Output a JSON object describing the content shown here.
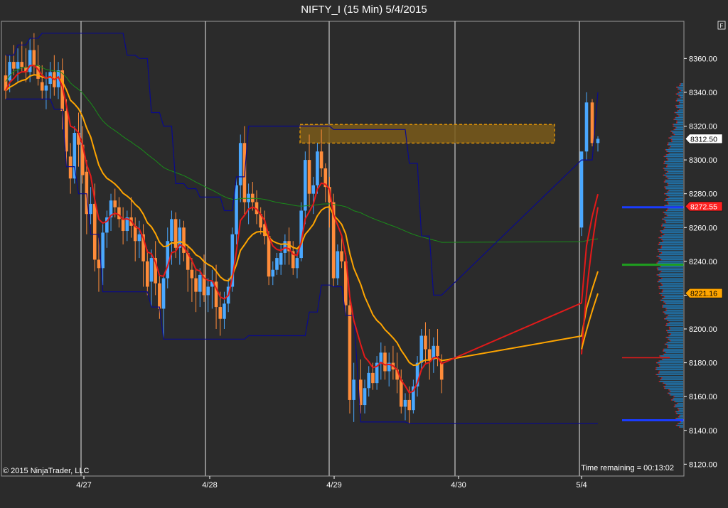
{
  "chart_data": {
    "type": "candlestick",
    "title": "NIFTY_I (15 Min)  5/4/2015",
    "x_labels": [
      "4/27",
      "4/28",
      "4/29",
      "4/30",
      "5/4"
    ],
    "y_ticks": [
      8120,
      8140,
      8160,
      8180,
      8200,
      8220,
      8240,
      8260,
      8280,
      8300,
      8320,
      8340,
      8360
    ],
    "y_tick_labels": [
      "8120.00",
      "8140.00",
      "8160.00",
      "8180.00",
      "8200.00",
      "8220.00",
      "8240.00",
      "8260.00",
      "8280.00",
      "8300.00",
      "8320.00",
      "8340.00",
      "8360.00"
    ],
    "ylim": [
      8113,
      8382
    ],
    "price_markers": [
      {
        "value": 8312.5,
        "label": "8312.50",
        "color": "#ffffff",
        "text_color": "#000000"
      },
      {
        "value": 8272.55,
        "label": "8272.55",
        "color": "#ff2020",
        "text_color": "#ffffff"
      },
      {
        "value": 8221.16,
        "label": "8221.16",
        "color": "#ffa500",
        "text_color": "#000000"
      }
    ],
    "resistance_zone": {
      "from": 8310,
      "to": 8321
    },
    "candles": [
      [
        8350,
        8362,
        8336,
        8341
      ],
      [
        8347,
        8362,
        8340,
        8358
      ],
      [
        8358,
        8368,
        8350,
        8354
      ],
      [
        8354,
        8366,
        8346,
        8358
      ],
      [
        8358,
        8370,
        8352,
        8355
      ],
      [
        8355,
        8366,
        8346,
        8352
      ],
      [
        8352,
        8372,
        8346,
        8365
      ],
      [
        8365,
        8375,
        8350,
        8356
      ],
      [
        8356,
        8368,
        8344,
        8348
      ],
      [
        8346,
        8356,
        8336,
        8341
      ],
      [
        8341,
        8352,
        8330,
        8344
      ],
      [
        8345,
        8358,
        8336,
        8352
      ],
      [
        8352,
        8362,
        8338,
        8343
      ],
      [
        8343,
        8358,
        8336,
        8353
      ],
      [
        8353,
        8360,
        8318,
        8329
      ],
      [
        8329,
        8336,
        8296,
        8305
      ],
      [
        8302,
        8310,
        8280,
        8289
      ],
      [
        8289,
        8320,
        8286,
        8316
      ],
      [
        8316,
        8328,
        8296,
        8309
      ],
      [
        8309,
        8320,
        8286,
        8291
      ],
      [
        8293,
        8300,
        8256,
        8268
      ],
      [
        8268,
        8284,
        8262,
        8274
      ],
      [
        8274,
        8286,
        8234,
        8241
      ],
      [
        8241,
        8254,
        8222,
        8236
      ],
      [
        8236,
        8262,
        8226,
        8257
      ],
      [
        8257,
        8270,
        8248,
        8266
      ],
      [
        8266,
        8280,
        8258,
        8276
      ],
      [
        8276,
        8283,
        8266,
        8272
      ],
      [
        8272,
        8278,
        8260,
        8265
      ],
      [
        8265,
        8272,
        8250,
        8258
      ],
      [
        8258,
        8270,
        8252,
        8266
      ],
      [
        8266,
        8278,
        8254,
        8261
      ],
      [
        8261,
        8266,
        8240,
        8252
      ],
      [
        8252,
        8264,
        8242,
        8256
      ],
      [
        8256,
        8262,
        8225,
        8240
      ],
      [
        8240,
        8247,
        8220,
        8225
      ],
      [
        8228,
        8247,
        8213,
        8242
      ],
      [
        8242,
        8252,
        8220,
        8227
      ],
      [
        8227,
        8232,
        8206,
        8212
      ],
      [
        8212,
        8232,
        8194,
        8230
      ],
      [
        8230,
        8260,
        8224,
        8252
      ],
      [
        8252,
        8270,
        8238,
        8265
      ],
      [
        8265,
        8269,
        8242,
        8248
      ],
      [
        8248,
        8265,
        8238,
        8260
      ],
      [
        8260,
        8264,
        8240,
        8245
      ],
      [
        8245,
        8250,
        8222,
        8235
      ],
      [
        8235,
        8242,
        8216,
        8230
      ],
      [
        8230,
        8236,
        8210,
        8222
      ],
      [
        8222,
        8236,
        8213,
        8232
      ],
      [
        8232,
        8244,
        8216,
        8220
      ],
      [
        8220,
        8230,
        8210,
        8225
      ],
      [
        8225,
        8235,
        8212,
        8228
      ],
      [
        8228,
        8238,
        8200,
        8213
      ],
      [
        8213,
        8222,
        8196,
        8206
      ],
      [
        8206,
        8222,
        8200,
        8215
      ],
      [
        8215,
        8230,
        8210,
        8225
      ],
      [
        8225,
        8260,
        8222,
        8256
      ],
      [
        8256,
        8290,
        8250,
        8285
      ],
      [
        8285,
        8315,
        8275,
        8310
      ],
      [
        8310,
        8320,
        8268,
        8275
      ],
      [
        8275,
        8286,
        8262,
        8280
      ],
      [
        8280,
        8287,
        8270,
        8275
      ],
      [
        8275,
        8282,
        8262,
        8268
      ],
      [
        8268,
        8272,
        8256,
        8260
      ],
      [
        8262,
        8270,
        8250,
        8255
      ],
      [
        8255,
        8258,
        8226,
        8231
      ],
      [
        8231,
        8240,
        8226,
        8235
      ],
      [
        8235,
        8245,
        8232,
        8242
      ],
      [
        8238,
        8250,
        8232,
        8245
      ],
      [
        8245,
        8256,
        8238,
        8252
      ],
      [
        8252,
        8260,
        8238,
        8246
      ],
      [
        8246,
        8252,
        8232,
        8236
      ],
      [
        8236,
        8248,
        8230,
        8242
      ],
      [
        8242,
        8275,
        8240,
        8270
      ],
      [
        8270,
        8305,
        8262,
        8300
      ],
      [
        8300,
        8315,
        8272,
        8280
      ],
      [
        8280,
        8290,
        8268,
        8285
      ],
      [
        8285,
        8310,
        8280,
        8305
      ],
      [
        8305,
        8318,
        8290,
        8295
      ],
      [
        8295,
        8298,
        8275,
        8284
      ],
      [
        8284,
        8290,
        8260,
        8275
      ],
      [
        8275,
        8280,
        8225,
        8230
      ],
      [
        8230,
        8250,
        8226,
        8246
      ],
      [
        8246,
        8255,
        8236,
        8240
      ],
      [
        8240,
        8245,
        8208,
        8214
      ],
      [
        8214,
        8220,
        8150,
        8158
      ],
      [
        8158,
        8180,
        8145,
        8170
      ],
      [
        8170,
        8182,
        8150,
        8155
      ],
      [
        8155,
        8170,
        8150,
        8165
      ],
      [
        8165,
        8178,
        8160,
        8174
      ],
      [
        8174,
        8180,
        8164,
        8168
      ],
      [
        8168,
        8184,
        8164,
        8180
      ],
      [
        8180,
        8192,
        8170,
        8186
      ],
      [
        8186,
        8190,
        8170,
        8175
      ],
      [
        8175,
        8186,
        8166,
        8180
      ],
      [
        8180,
        8190,
        8170,
        8176
      ],
      [
        8176,
        8186,
        8162,
        8170
      ],
      [
        8170,
        8176,
        8150,
        8154
      ],
      [
        8154,
        8162,
        8146,
        8158
      ],
      [
        8158,
        8166,
        8144,
        8152
      ],
      [
        8152,
        8170,
        8150,
        8166
      ],
      [
        8166,
        8184,
        8160,
        8180
      ],
      [
        8180,
        8200,
        8175,
        8196
      ],
      [
        8196,
        8204,
        8180,
        8188
      ],
      [
        8188,
        8200,
        8170,
        8182
      ],
      [
        8182,
        8195,
        8174,
        8190
      ],
      [
        8190,
        8200,
        8178,
        8184
      ],
      [
        8180,
        8185,
        8162,
        8170
      ],
      [
        8260,
        8300,
        8255,
        8305
      ],
      [
        8305,
        8340,
        8300,
        8334
      ],
      [
        8334,
        8336,
        8308,
        8310
      ],
      [
        8310,
        8314,
        8305,
        8312.5
      ]
    ],
    "volume_profile": {
      "poc_green": 8238,
      "blue_highs": [
        8272,
        8146
      ],
      "red_high": 8183
    }
  },
  "watermark": "© 2015 NinjaTrader, LLC",
  "time_remaining": "Time remaining = 00:13:02",
  "corner_badge": "F",
  "colors": {
    "background": "#2b2b2b",
    "up": "#4aa8ff",
    "down": "#ff8c3a",
    "ema_fast": "#e31a1a",
    "ema_slow": "#ffa500",
    "vwap": "#1a8c1a",
    "band": "#0a0a8c",
    "profile": "#1f78b4"
  }
}
